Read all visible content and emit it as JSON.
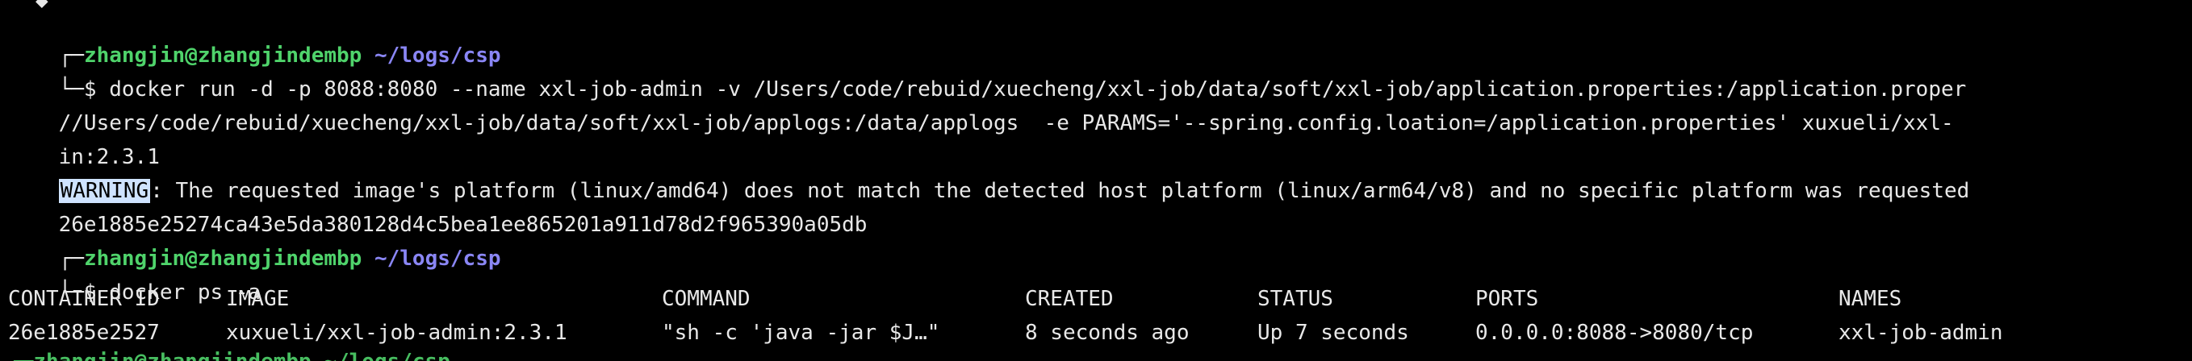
{
  "prompt": {
    "user": "zhangjin@zhangjindembp",
    "path": "~/logs/csp",
    "box_top": "┌─",
    "box_bottom": "└─$ "
  },
  "commands": {
    "run_line1": "docker run -d -p 8088:8080 --name xxl-job-admin -v /Users/code/rebuid/xuecheng/xxl-job/data/soft/xxl-job/application.properties:/application.proper",
    "run_line2": "//Users/code/rebuid/xuecheng/xxl-job/data/soft/xxl-job/applogs:/data/applogs  -e PARAMS='--spring.config.loation=/application.properties' xuxueli/xxl-",
    "run_line3": "in:2.3.1",
    "ps": "docker ps -a"
  },
  "output": {
    "warning_label": "WARNING",
    "warning_text": ": The requested image's platform (linux/amd64) does not match the detected host platform (linux/arm64/v8) and no specific platform was requested",
    "container_hash": "26e1885e25274ca43e5da380128d4c5bea1ee865201a911d78d2f965390a05db"
  },
  "table": {
    "headers": [
      "CONTAINER ID",
      "IMAGE",
      "COMMAND",
      "CREATED",
      "STATUS",
      "PORTS",
      "NAMES"
    ],
    "rows": [
      [
        "26e1885e2527",
        "xuxueli/xxl-job-admin:2.3.1",
        "\"sh -c 'java -jar $J…\"",
        "8 seconds ago",
        "Up 7 seconds",
        "0.0.0.0:8088->8080/tcp",
        "xxl-job-admin"
      ]
    ]
  },
  "partial_next_prompt": "┌─zhangjin@zhangjindembp ~/logs/csp",
  "colors": {
    "background": "#000000",
    "user": "#4fd36b",
    "path": "#8a86f5",
    "text": "#e8e8e8",
    "selection": "#cfe3ff"
  }
}
